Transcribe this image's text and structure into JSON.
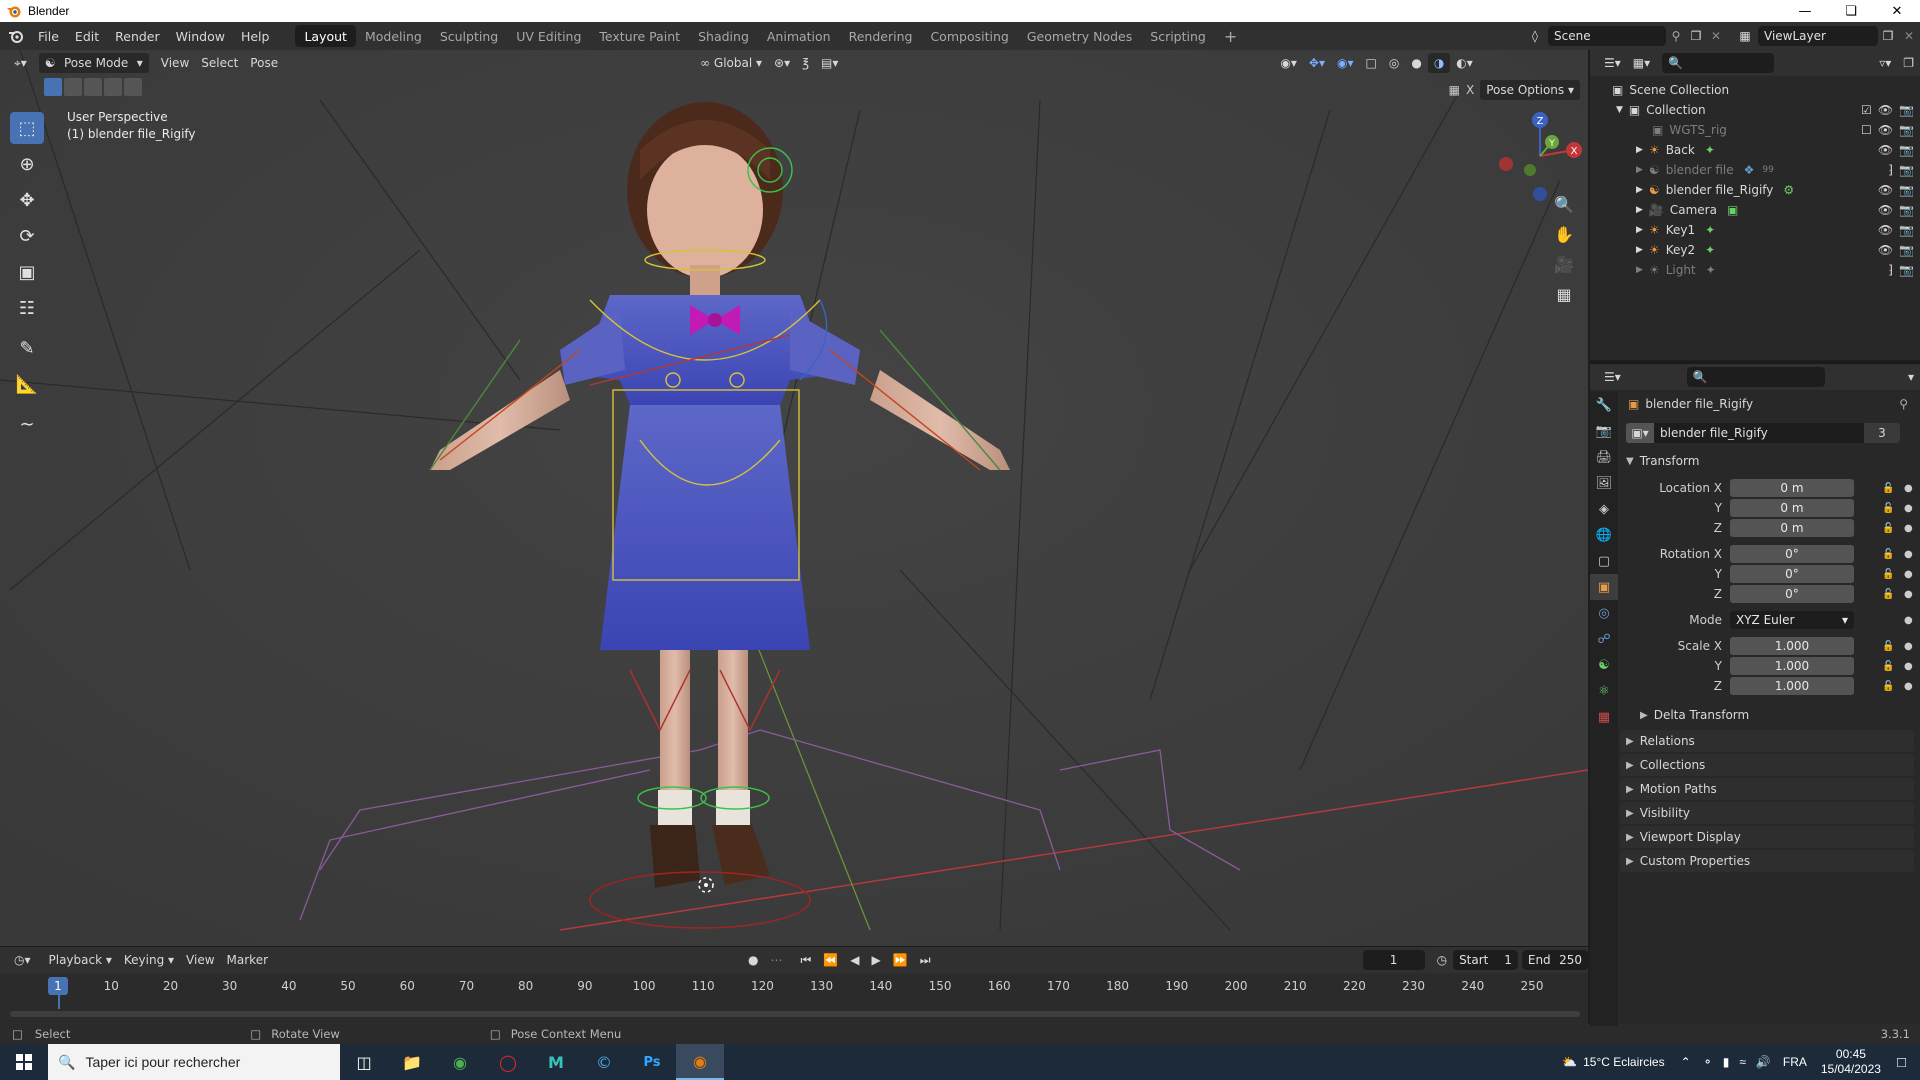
{
  "window": {
    "title": "Blender",
    "controls": [
      "minimize",
      "restore",
      "close"
    ]
  },
  "menu": {
    "items": [
      "File",
      "Edit",
      "Render",
      "Window",
      "Help"
    ]
  },
  "workspaces": [
    "Layout",
    "Modeling",
    "Sculpting",
    "UV Editing",
    "Texture Paint",
    "Shading",
    "Animation",
    "Rendering",
    "Compositing",
    "Geometry Nodes",
    "Scripting"
  ],
  "active_workspace": "Layout",
  "scene": {
    "name": "Scene",
    "view_layer": "ViewLayer"
  },
  "viewport": {
    "mode": "Pose Mode",
    "menus": [
      "View",
      "Select",
      "Pose"
    ],
    "orientation": "Global",
    "pose_options": "Pose Options",
    "perspective": "User Perspective",
    "active_object": "(1) blender file_Rigify",
    "gizmo_axes": [
      "Z",
      "Y",
      "X"
    ]
  },
  "outliner": {
    "root": "Scene Collection",
    "collection": "Collection",
    "items": [
      {
        "name": "WGTS_rig",
        "dim": true
      },
      {
        "name": "Back",
        "dim": false
      },
      {
        "name": "blender file",
        "dim": true,
        "extra": "99"
      },
      {
        "name": "blender file_Rigify",
        "dim": false
      },
      {
        "name": "Camera",
        "dim": false
      },
      {
        "name": "Key1",
        "dim": false
      },
      {
        "name": "Key2",
        "dim": false
      },
      {
        "name": "Light",
        "dim": true
      }
    ]
  },
  "properties": {
    "object_name": "blender file_Rigify",
    "data_name": "blender file_Rigify",
    "users": "3",
    "transform_label": "Transform",
    "location": {
      "label": "Location X",
      "x": "0 m",
      "y": "0 m",
      "z": "0 m"
    },
    "rotation": {
      "label": "Rotation X",
      "x": "0°",
      "y": "0°",
      "z": "0°"
    },
    "mode_label": "Mode",
    "mode_value": "XYZ Euler",
    "scale": {
      "label": "Scale X",
      "x": "1.000",
      "y": "1.000",
      "z": "1.000"
    },
    "axis_y": "Y",
    "axis_z": "Z",
    "delta_transform": "Delta Transform",
    "panels": [
      "Relations",
      "Collections",
      "Motion Paths",
      "Visibility",
      "Viewport Display",
      "Custom Properties"
    ]
  },
  "timeline": {
    "menus": [
      "Playback",
      "Keying",
      "View",
      "Marker"
    ],
    "current_frame": "1",
    "start_label": "Start",
    "start": "1",
    "end_label": "End",
    "end": "250",
    "ticks": [
      "1",
      "10",
      "20",
      "30",
      "40",
      "50",
      "60",
      "70",
      "80",
      "90",
      "100",
      "110",
      "120",
      "130",
      "140",
      "150",
      "160",
      "170",
      "180",
      "190",
      "200",
      "210",
      "220",
      "230",
      "240",
      "250"
    ]
  },
  "statusbar": {
    "select": "Select",
    "rotate": "Rotate View",
    "context": "Pose Context Menu",
    "version": "3.3.1"
  },
  "taskbar": {
    "search_placeholder": "Taper ici pour rechercher",
    "weather": "15°C  Eclaircies",
    "language": "FRA",
    "time": "00:45",
    "date": "15/04/2023"
  }
}
